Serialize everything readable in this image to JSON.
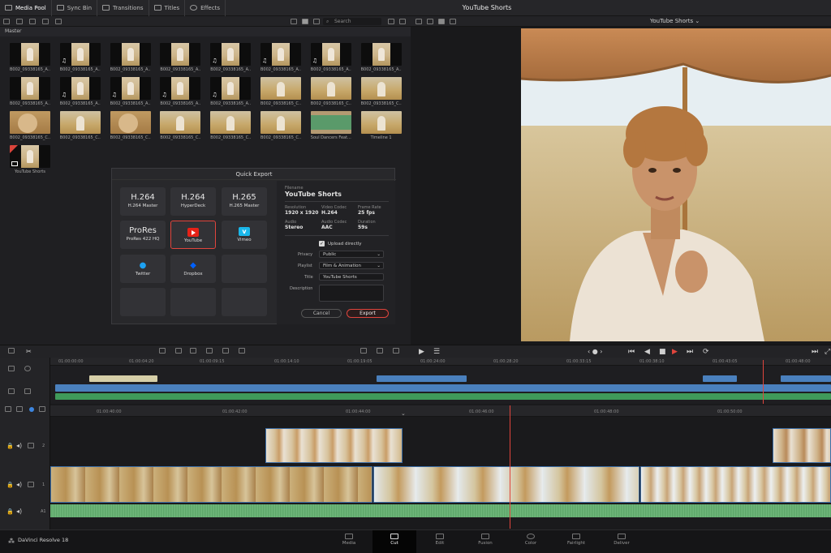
{
  "app": {
    "window_title": "YouTube Shorts",
    "brand": "DaVinci Resolve 18"
  },
  "top_tabs": [
    {
      "label": "Media Pool",
      "icon": "media-pool-icon"
    },
    {
      "label": "Sync Bin",
      "icon": "sync-bin-icon"
    },
    {
      "label": "Transitions",
      "icon": "transitions-icon"
    },
    {
      "label": "Titles",
      "icon": "titles-icon"
    },
    {
      "label": "Effects",
      "icon": "effects-icon"
    }
  ],
  "media_pool": {
    "search_placeholder": "Search",
    "bin_label": "Master",
    "clips": [
      "B002_09338165_A...",
      "B002_09338165_A...",
      "B002_09338165_A...",
      "B002_09338165_A...",
      "B002_09338165_A...",
      "B002_09338165_A...",
      "B002_09338165_A...",
      "B002_09338165_A...",
      "B002_09338165_A...",
      "B002_09338165_A...",
      "B002_09338165_A...",
      "B002_09338165_A...",
      "B002_09338165_A...",
      "B002_09338165_C...",
      "B002_09338165_C...",
      "B002_09338165_C...",
      "B002_09338165_C...",
      "B002_09338165_C...",
      "B002_09338165_C...",
      "B002_09338165_C...",
      "B002_09338165_C...",
      "B002_09338165_C...",
      "Soul Dancers Feat...",
      "Timeline 1",
      "YouTube Shorts"
    ]
  },
  "viewer": {
    "title": "YouTube Shorts"
  },
  "quick_export": {
    "title": "Quick Export",
    "presets": [
      {
        "big": "H.264",
        "small": "H.264 Master"
      },
      {
        "big": "H.264",
        "small": "HyperDeck"
      },
      {
        "big": "H.265",
        "small": "H.265 Master"
      },
      {
        "big": "ProRes",
        "small": "ProRes 422 HQ"
      },
      {
        "big": "",
        "small": "YouTube"
      },
      {
        "big": "",
        "small": "Vimeo"
      },
      {
        "big": "",
        "small": "Twitter"
      },
      {
        "big": "",
        "small": "Dropbox"
      }
    ],
    "filename_label": "Filename",
    "filename": "YouTube Shorts",
    "resolution_label": "Resolution",
    "resolution": "1920 x 1920",
    "video_codec_label": "Video Codec",
    "video_codec": "H.264",
    "frame_rate_label": "Frame Rate",
    "frame_rate": "25 fps",
    "audio_label": "Audio",
    "audio": "Stereo",
    "audio_codec_label": "Audio Codec",
    "audio_codec": "AAC",
    "duration_label": "Duration",
    "duration": "59s",
    "upload_label": "Upload directly",
    "privacy_label": "Privacy",
    "privacy": "Public",
    "playlist_label": "Playlist",
    "playlist": "Film & Animation",
    "title_label": "Title",
    "title_value": "YouTube Shorts",
    "description_label": "Description",
    "cancel": "Cancel",
    "export": "Export"
  },
  "upper_timeline": {
    "timecodes": [
      "01:00:00:00",
      "01:00:04:20",
      "01:00:09:15",
      "01:00:14:10",
      "01:00:19:05",
      "01:00:24:00",
      "01:00:28:20",
      "01:00:33:15",
      "01:00:38:10",
      "01:00:43:05",
      "01:00:48:00"
    ]
  },
  "lower_timeline": {
    "timecodes": [
      "01:00:40:00",
      "01:00:42:00",
      "01:00:44:00",
      "01:00:46:00",
      "01:00:48:00",
      "01:00:50:00"
    ],
    "track_labels": [
      "2",
      "1",
      "A1"
    ]
  },
  "pages": [
    "Media",
    "Cut",
    "Edit",
    "Fusion",
    "Color",
    "Fairlight",
    "Deliver"
  ],
  "active_page": "Cut",
  "colors": {
    "accent_red": "#e0453d",
    "clip_blue": "#3d6fa8",
    "audio_green": "#5fa56a"
  }
}
